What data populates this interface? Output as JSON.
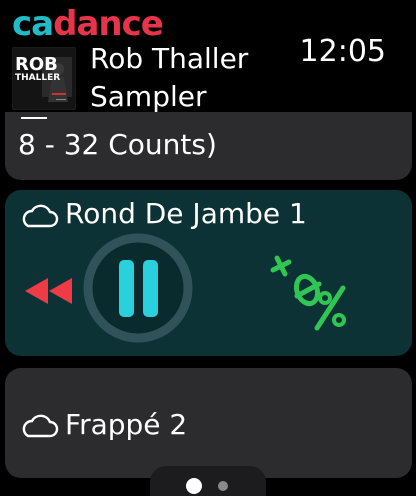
{
  "app": {
    "logo_part1": "ca",
    "logo_part2": "dance",
    "time": "12:05"
  },
  "now_playing": {
    "title_line1": "Rob Thaller",
    "title_line2": "Sampler",
    "cover_text_top": "ROB",
    "cover_text_side": "THALLER"
  },
  "tracks": [
    {
      "label_partial": "8 - 32 Counts)",
      "cloud": true
    },
    {
      "label": "Rond De Jambe 1",
      "cloud": true,
      "active": true
    },
    {
      "label": "Frappé 2",
      "cloud": true
    }
  ],
  "controls": {
    "rewind_icon": "rewind-icon",
    "pause_icon": "pause-icon",
    "tempo_label": "+0%",
    "colors": {
      "rewind": "#ee3b45",
      "pause": "#2ad0dc",
      "tempo": "#31c553",
      "ring": "#2f5358"
    }
  },
  "pager": {
    "pages": 2,
    "current": 1
  }
}
